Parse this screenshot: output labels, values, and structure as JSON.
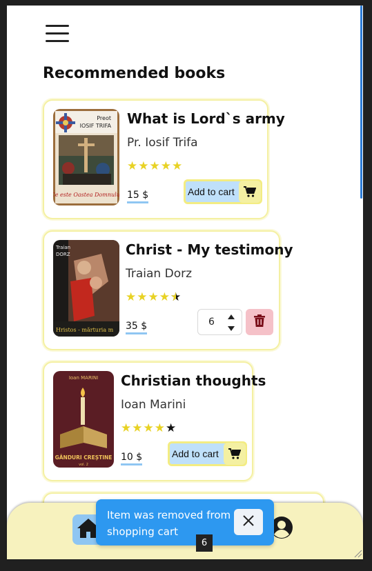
{
  "header": {
    "menu_icon": "hamburger-icon"
  },
  "section_title": "Recommended books",
  "books": [
    {
      "title": "What is Lord`s army",
      "author": "Pr. Iosif Trifa",
      "rating": 5,
      "price": "15 $",
      "add_to_cart_label": "Add to cart",
      "cover": {
        "top_text_1": "Preot",
        "top_text_2": "IOSIF TRIFA",
        "bottom_text": "Ce este Oastea Domnului",
        "top_color": "#ede2cf",
        "bottom_color": "#f1e6d4"
      }
    },
    {
      "title": "Christ - My testimony",
      "author": "Traian Dorz",
      "rating": 4.5,
      "price": "35 $",
      "quantity": "6",
      "cover": {
        "top_text_1": "Traian",
        "top_text_2": "DORZ",
        "bottom_text": "Hristos - mărturia m"
      }
    },
    {
      "title": "Christian thoughts",
      "author": "Ioan Marini",
      "rating": 4,
      "price": "10 $",
      "add_to_cart_label": "Add to cart",
      "cover": {
        "top_text_1": "Ioan MARINI",
        "bottom_text": "GÂNDURI CREȘTINE",
        "bottom_small": "vol. 2"
      }
    }
  ],
  "toast": {
    "message": "Item was removed from shopping cart",
    "counter": "6"
  },
  "nav": {
    "home_icon": "home-icon",
    "profile_icon": "user-circle-icon"
  },
  "colors": {
    "card_border": "#f4f0a2",
    "price_underline": "#8fc6f2",
    "star": "#e8d224",
    "toast_bg": "#2d98f0",
    "nav_bg": "#f7f2be",
    "delete_bg": "#f5c1c8"
  }
}
